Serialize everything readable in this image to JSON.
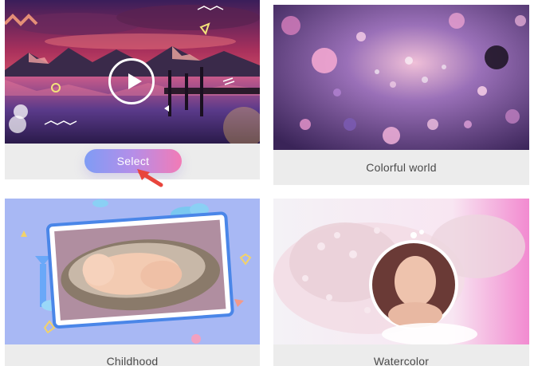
{
  "templates": [
    {
      "caption": "",
      "action_label": "Select",
      "media": "mountain-lake-sunset"
    },
    {
      "caption": "Colorful world",
      "media": "bokeh-particles"
    },
    {
      "caption": "Childhood",
      "media": "sleeping-baby-frame"
    },
    {
      "caption": "Watercolor",
      "media": "woman-blossom-portrait"
    }
  ],
  "icons": {
    "play": "play-icon",
    "cursor": "arrow-cursor-icon"
  },
  "colors": {
    "select_gradient": [
      "#7f9cf5",
      "#f27bb6"
    ],
    "card_bg": "#ececec",
    "cursor": "#e8453c"
  }
}
